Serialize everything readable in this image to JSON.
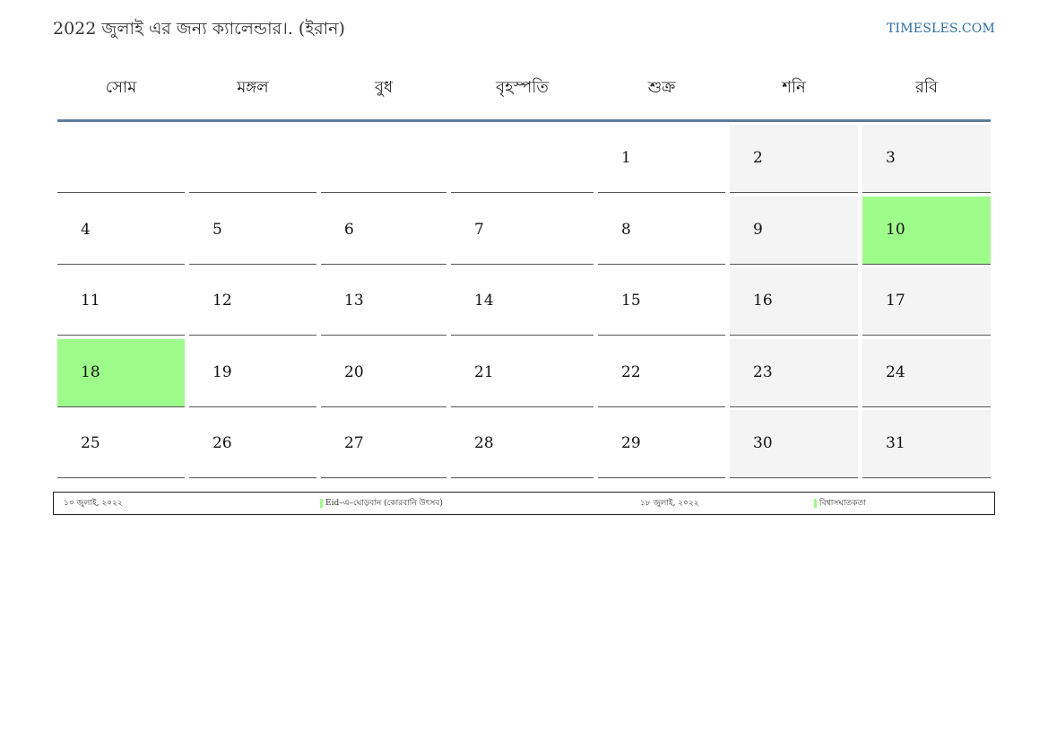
{
  "header": {
    "title": "2022 জুলাই এর জন্য ক্যালেন্ডার।. (ইরান)",
    "site": "TIMESLES.COM"
  },
  "calendar": {
    "weekdays": [
      "সোম",
      "মঙ্গল",
      "বুধ",
      "বৃহস্পতি",
      "শুক্র",
      "শনি",
      "রবি"
    ],
    "weeks": [
      [
        "",
        "",
        "",
        "",
        "1",
        "2",
        "3"
      ],
      [
        "4",
        "5",
        "6",
        "7",
        "8",
        "9",
        "10"
      ],
      [
        "11",
        "12",
        "13",
        "14",
        "15",
        "16",
        "17"
      ],
      [
        "18",
        "19",
        "20",
        "21",
        "22",
        "23",
        "24"
      ],
      [
        "25",
        "26",
        "27",
        "28",
        "29",
        "30",
        "31"
      ]
    ],
    "holidays": [
      "10",
      "18"
    ]
  },
  "legend": [
    {
      "date": "১০ জুলাই, ২০২২",
      "name": "Eid–এ–ঘোড়বান (কোরবানি উৎসব)"
    },
    {
      "date": "১৮ জুলাই, ২০২২",
      "name": "বিশ্বাসঘাতকতা"
    }
  ],
  "colors": {
    "holiday": "#9efc8a",
    "weekend": "#f4f4f4",
    "header_rule": "#5e7b9c",
    "link": "#2e6e9e"
  }
}
